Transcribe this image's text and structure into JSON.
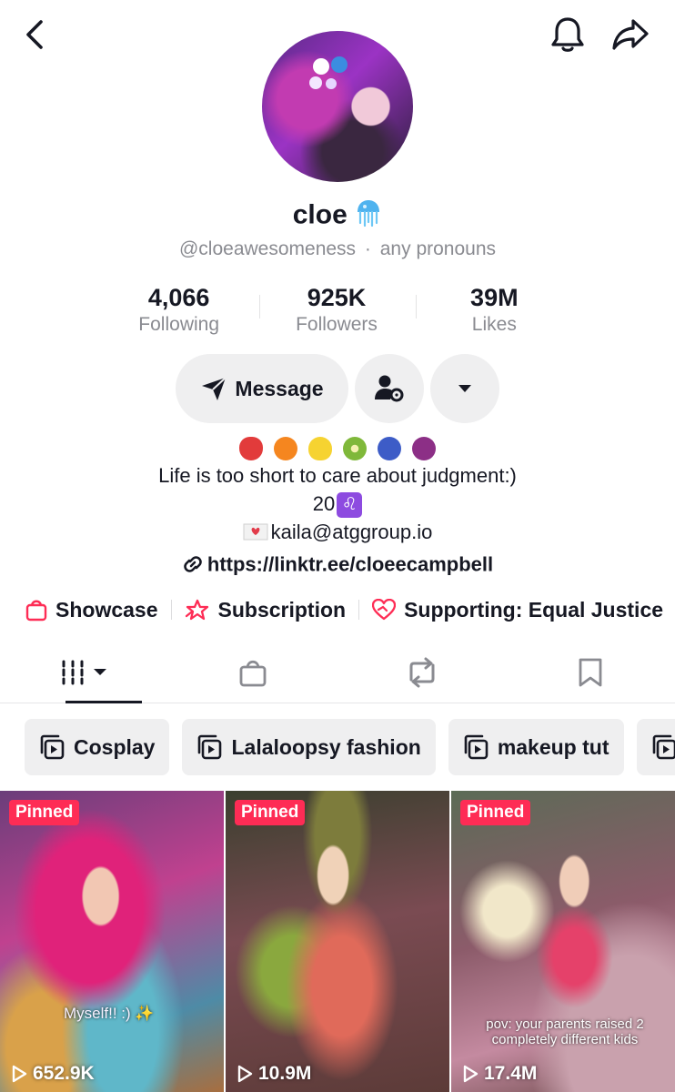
{
  "header": {
    "back_icon": "chevron-left-icon",
    "bell_icon": "bell-icon",
    "share_icon": "share-arrow-icon"
  },
  "profile": {
    "name": "cloe",
    "name_emoji": "jellyfish-emoji",
    "handle": "@cloeawesomeness",
    "pronouns": "any pronouns",
    "handle_separator": "·"
  },
  "stats": [
    {
      "value": "4,066",
      "label": "Following"
    },
    {
      "value": "925K",
      "label": "Followers"
    },
    {
      "value": "39M",
      "label": "Likes"
    }
  ],
  "actions": {
    "message_label": "Message",
    "message_icon": "paper-plane-icon",
    "friends_icon": "user-settings-icon",
    "more_icon": "caret-down-icon"
  },
  "bio": {
    "emoji_line": [
      "strawberry",
      "tangerine",
      "lemon",
      "kiwi",
      "blueberries",
      "grapes"
    ],
    "line1": "Life is too short to care about judgment:)",
    "age": "20",
    "zodiac": "♌",
    "email": "kaila@atggroup.io",
    "link": "https://linktr.ee/cloeecampbell"
  },
  "features": [
    {
      "label": "Showcase",
      "icon": "shopping-bag-icon"
    },
    {
      "label": "Subscription",
      "icon": "star-badge-icon"
    },
    {
      "label": "Supporting: Equal Justice",
      "icon": "heart-hand-icon"
    }
  ],
  "tabs": [
    {
      "name": "videos",
      "icon": "grid-icon",
      "active": true
    },
    {
      "name": "shop",
      "icon": "bag-icon",
      "active": false
    },
    {
      "name": "reposts",
      "icon": "repost-icon",
      "active": false
    },
    {
      "name": "saved",
      "icon": "bookmark-icon",
      "active": false
    }
  ],
  "playlists": [
    {
      "label": "Cosplay"
    },
    {
      "label": "Lalaloopsy fashion"
    },
    {
      "label": "makeup tut"
    }
  ],
  "videos": [
    {
      "badge": "Pinned",
      "views": "652.9K",
      "caption": "Myself!! :) ✨"
    },
    {
      "badge": "Pinned",
      "views": "10.9M",
      "caption": ""
    },
    {
      "badge": "Pinned",
      "views": "17.4M",
      "caption": "pov: your parents raised 2 completely different kids"
    }
  ],
  "colors": {
    "accent": "#fe2c55",
    "text": "#161823",
    "muted": "#8a8b91",
    "button_bg": "#efeff0"
  }
}
